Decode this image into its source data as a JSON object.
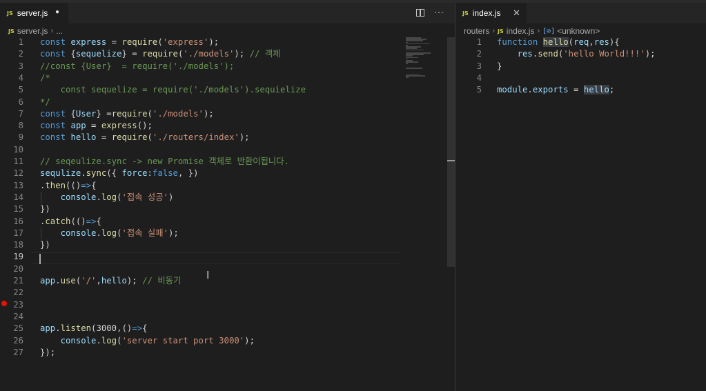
{
  "left_editor": {
    "tab": {
      "icon": "JS",
      "filename": "server.js",
      "modified_dot": "●"
    },
    "actions": {
      "split_label": "",
      "more": "···"
    },
    "breadcrumb": {
      "icon": "JS",
      "file": "server.js",
      "sep": "›",
      "rest": "..."
    },
    "line_numbers": [
      "1",
      "2",
      "3",
      "4",
      "5",
      "6",
      "7",
      "8",
      "9",
      "10",
      "11",
      "12",
      "13",
      "14",
      "15",
      "16",
      "17",
      "18",
      "19",
      "20",
      "21",
      "22",
      "23",
      "24",
      "25",
      "26",
      "27"
    ],
    "code": {
      "l1": [
        "const",
        " ",
        "express",
        " = ",
        "require",
        "(",
        "'express'",
        ");"
      ],
      "l2": [
        "const",
        " {",
        "sequelize",
        "} = ",
        "require",
        "(",
        "'./models'",
        "); ",
        "// 객체"
      ],
      "l3": [
        "//const {User}  = require('./models');"
      ],
      "l4": [
        "/*"
      ],
      "l5": [
        "    const sequelize = require('./models').sequielize"
      ],
      "l6": [
        "*/"
      ],
      "l7": [
        "const",
        " {",
        "User",
        "} =",
        "require",
        "(",
        "'./models'",
        ");"
      ],
      "l8": [
        "const",
        " ",
        "app",
        " = ",
        "express",
        "();"
      ],
      "l9": [
        "const",
        " ",
        "hello",
        " = ",
        "require",
        "(",
        "'./routers/index'",
        ");"
      ],
      "l11": [
        "// seqeulize.sync -> new Promise 객체로 반환이됩니다."
      ],
      "l12": [
        "sequlize",
        ".",
        "sync",
        "({ ",
        "force",
        ":",
        "false",
        ", })"
      ],
      "l13": [
        ".",
        "then",
        "(()",
        "=>",
        "{"
      ],
      "l14": [
        "    ",
        "console",
        ".",
        "log",
        "(",
        "'접속 성공'",
        ")"
      ],
      "l15": [
        "})"
      ],
      "l16": [
        ".",
        "catch",
        "(()",
        "=>",
        "{"
      ],
      "l17": [
        "    ",
        "console",
        ".",
        "log",
        "(",
        "'접속 실패'",
        ");"
      ],
      "l18": [
        "})"
      ],
      "l21": [
        "app",
        ".",
        "use",
        "(",
        "'/'",
        ",",
        "hello",
        "); ",
        "// 비동기"
      ],
      "l25": [
        "app",
        ".",
        "listen",
        "(",
        "3000",
        ",",
        "()",
        "=>",
        "{"
      ],
      "l26": [
        "    ",
        "console",
        ".",
        "log",
        "(",
        "'server start port 3000'",
        ");"
      ],
      "l27": [
        "});"
      ]
    }
  },
  "right_editor": {
    "tab": {
      "icon": "JS",
      "filename": "index.js",
      "close": "✕"
    },
    "breadcrumb": {
      "folder": "routers",
      "sep": "›",
      "icon": "JS",
      "file": "index.js",
      "symbol_icon": "[⊘]",
      "symbol": "<unknown>"
    },
    "line_numbers": [
      "1",
      "2",
      "3",
      "4",
      "5"
    ],
    "code": {
      "l1": [
        "function",
        " ",
        "hello",
        "(",
        "req",
        ",",
        "res",
        "){"
      ],
      "l2": [
        "    ",
        "res",
        ".",
        "send",
        "(",
        "'hello World!!!'",
        ");"
      ],
      "l3": [
        "}"
      ],
      "l5": [
        "module",
        ".",
        "exports",
        " = ",
        "hello",
        ";"
      ]
    }
  },
  "colors": {
    "keyword": "#569cd6",
    "variable": "#9cdcfe",
    "string": "#ce9178",
    "function": "#dcdcaa",
    "comment": "#6a9955",
    "breakpoint": "#e51400"
  }
}
